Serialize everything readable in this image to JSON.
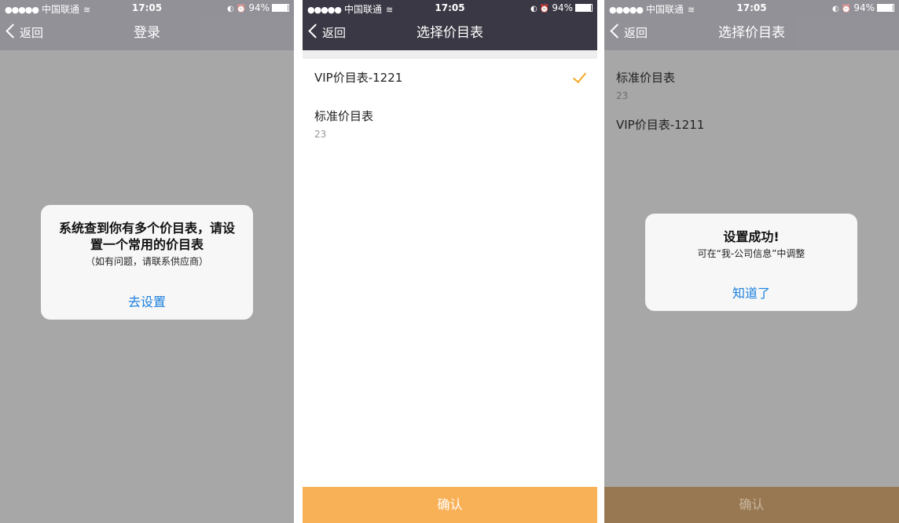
{
  "status_bar": {
    "dots": "●●●●●",
    "carrier": "中国联通",
    "wifi": "≋",
    "time": "17:05",
    "icons": "◐ ⏰",
    "battery_pct": "94%",
    "battery_level": 0.94
  },
  "screen1": {
    "nav": {
      "back_label": "返回",
      "title": "登录"
    },
    "alert": {
      "title": "系统查到你有多个价目表，请设置一个常用的价目表",
      "subtitle": "（如有问题，请联系供应商）",
      "button": "去设置"
    }
  },
  "screen2": {
    "nav": {
      "back_label": "返回",
      "title": "选择价目表"
    },
    "items": [
      {
        "name": "VIP价目表-1221",
        "count": "",
        "selected": true
      },
      {
        "name": "标准价目表",
        "count": "23",
        "selected": false
      }
    ],
    "confirm": "确认"
  },
  "screen3": {
    "nav": {
      "back_label": "返回",
      "title": "选择价目表"
    },
    "items": [
      {
        "name": "标准价目表",
        "count": "23"
      },
      {
        "name": "VIP价目表-1211",
        "count": ""
      }
    ],
    "alert": {
      "title": "设置成功!",
      "subtitle": "可在“我-公司信息”中调整",
      "button": "知道了"
    },
    "confirm": "确认"
  },
  "colors": {
    "nav_bg": "#3a3844",
    "accent": "#f5a623",
    "confirm_bg": "#f9b157",
    "link": "#1a7fde",
    "overlay": "#a7a7a7"
  }
}
